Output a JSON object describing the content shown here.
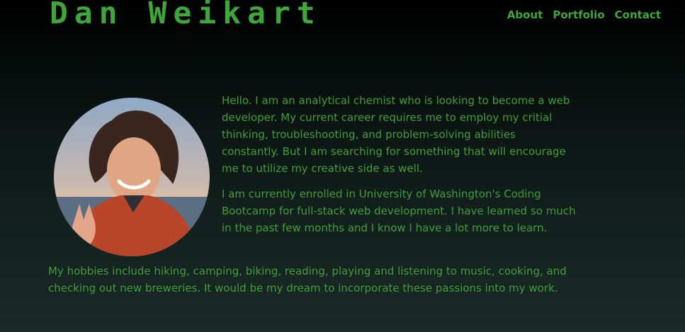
{
  "header": {
    "title": "Dan Weikart",
    "nav": [
      {
        "label": "About"
      },
      {
        "label": "Portfolio"
      },
      {
        "label": "Contact"
      }
    ]
  },
  "about": {
    "photo_icon": "profile-photo",
    "paragraphs": [
      "Hello. I am an analytical chemist who is looking to become a web developer. My current career requires me to employ my critial thinking, troubleshooting, and problem-solving abilities constantly. But I am searching for something that will encourage me to utilize my creative side as well.",
      "I am currently enrolled in University of Washington's Coding Bootcamp for full-stack web development. I have learned so much in the past few months and I know I have a lot more to learn."
    ],
    "hobbies": "My hobbies include hiking, camping, biking, reading, playing and listening to music, cooking, and checking out new breweries. It would be my dream to incorporate these passions into my work."
  },
  "colors": {
    "text": "#3f9e3a",
    "background_top": "#000000",
    "background_bottom": "#1a2a27"
  }
}
